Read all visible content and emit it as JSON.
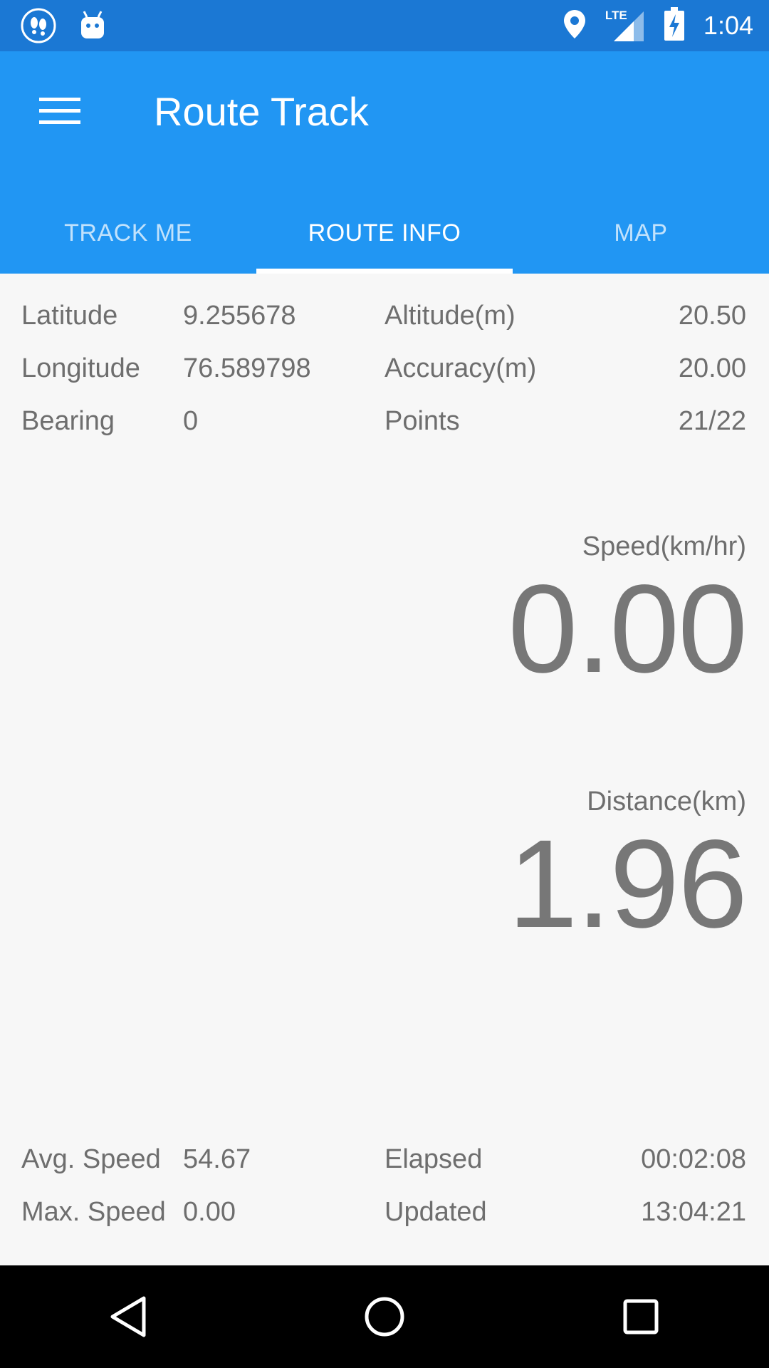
{
  "status_bar": {
    "time": "1:04",
    "network_label": "LTE",
    "left_icons": [
      "footsteps-icon",
      "android-icon"
    ],
    "right_icons": [
      "location-icon",
      "signal-icon",
      "battery-charging-icon"
    ]
  },
  "app_bar": {
    "title": "Route Track",
    "menu_icon": "hamburger-menu-icon",
    "tabs": [
      {
        "label": "TRACK ME",
        "active": false
      },
      {
        "label": "ROUTE INFO",
        "active": true
      },
      {
        "label": "MAP",
        "active": false
      }
    ]
  },
  "info": {
    "rows": [
      {
        "label1": "Latitude",
        "value1": "9.255678",
        "label2": "Altitude(m)",
        "value2": "20.50"
      },
      {
        "label1": "Longitude",
        "value1": "76.589798",
        "label2": "Accuracy(m)",
        "value2": "20.00"
      },
      {
        "label1": "Bearing",
        "value1": "0",
        "label2": "Points",
        "value2": "21/22"
      }
    ]
  },
  "speed": {
    "label": "Speed(km/hr)",
    "value": "0.00"
  },
  "distance": {
    "label": "Distance(km)",
    "value": "1.96"
  },
  "stats": {
    "rows": [
      {
        "label1": "Avg. Speed",
        "value1": "54.67",
        "label2": "Elapsed",
        "value2": "00:02:08"
      },
      {
        "label1": "Max. Speed",
        "value1": "0.00",
        "label2": "Updated",
        "value2": "13:04:21"
      }
    ]
  },
  "nav_bar": {
    "buttons": [
      "back-icon",
      "home-icon",
      "recents-icon"
    ]
  },
  "colors": {
    "status_bar": "#1b78d4",
    "app_bar": "#2196f3",
    "background": "#f7f7f7",
    "text": "#6e6e6e"
  }
}
